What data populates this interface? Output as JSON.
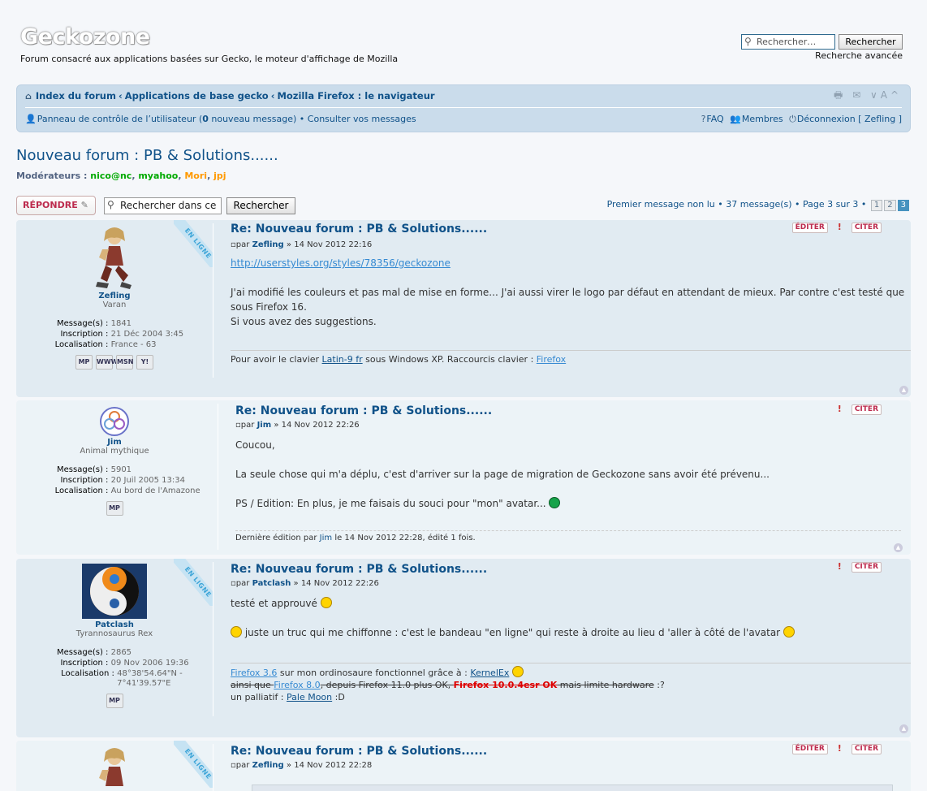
{
  "header": {
    "site_title": "Geckozone",
    "site_desc": "Forum consacré aux applications basées sur Gecko, le moteur d'affichage de Mozilla",
    "search_placeholder": "Rechercher…",
    "search_button": "Rechercher",
    "advanced_search": "Recherche avancée"
  },
  "navbar": {
    "crumbs": [
      "Index du forum",
      "Applications de base gecko",
      "Mozilla Firefox : le navigateur"
    ],
    "ucp_prefix": "Panneau de contrôle de l’utilisateur (",
    "ucp_count": "0",
    "ucp_suffix": " nouveau message)",
    "bullet": "•",
    "messages_link": "Consulter vos messages",
    "faq": "FAQ",
    "members": "Membres",
    "logout": "Déconnexion [ Zefling ]",
    "tools_glyphs": "🖶 ✉ ∨A^"
  },
  "forum": {
    "title": "Nouveau forum : PB & Solutions......",
    "moderators_label": "Modérateurs :",
    "mods": [
      "nico@nc",
      "myahoo",
      "Mori",
      "jpj"
    ],
    "mod_sep": ", "
  },
  "actionbar": {
    "reply_button": "RÉPONDRE",
    "search_topic_value": "Rechercher dans ce",
    "search_topic_button": "Rechercher",
    "unread_link": "Premier message non lu",
    "post_count": "37 message(s)",
    "page_info": "Page 3 sur 3",
    "pages": [
      "1",
      "2",
      "3"
    ],
    "bullet": "•"
  },
  "labels": {
    "online": "EN LIGNE",
    "messages": "Message(s) :",
    "inscription": "Inscription :",
    "localisation": "Localisation :",
    "by": "par",
    "edit": "ÉDITER",
    "quote": "CITER",
    "report_glyph": "!",
    "top_glyph": "▲"
  },
  "posts": [
    {
      "author": "Zefling",
      "rank": "Varan",
      "messages": "1841",
      "inscription": "21 Déc 2004 3:45",
      "localisation": "France - 63",
      "title": "Re: Nouveau forum : PB & Solutions......",
      "date": "14 Nov 2012 22:16",
      "link": "http://userstyles.org/styles/78356/geckozone",
      "p1": "J'ai modifié les couleurs et pas mal de mise en forme... J'ai aussi virer le logo par défaut en attendant de mieux. Par contre c'est testé que sous Firefox 16.",
      "p2": "Si vous avez des suggestions.",
      "sig_pre": "Pour avoir le clavier ",
      "sig_link1": "Latin-9 fr",
      "sig_mid": " sous Windows XP. Raccourcis clavier : ",
      "sig_link2": "Firefox",
      "contacts": [
        "MP",
        "WWW",
        "MSN",
        "Y!"
      ]
    },
    {
      "author": "Jim",
      "rank": "Animal mythique",
      "messages": "5901",
      "inscription": "20 Juil 2005 13:34",
      "localisation": "Au bord de l'Amazone",
      "title": "Re: Nouveau forum : PB & Solutions......",
      "date": "14 Nov 2012 22:26",
      "p1": "Coucou,",
      "p2": "La seule chose qui m'a déplu, c'est d'arriver sur la page de migration de Geckozone sans avoir été prévenu...",
      "p3": "PS / Edition: En plus, je me faisais du souci pour \"mon\" avatar...",
      "edit_pre": "Dernière édition par ",
      "edit_user": "Jim",
      "edit_post": " le 14 Nov 2012 22:28, édité 1 fois.",
      "contacts": [
        "MP"
      ]
    },
    {
      "author": "Patclash",
      "rank": "Tyrannosaurus Rex",
      "messages": "2865",
      "inscription": "09 Nov 2006 19:36",
      "localisation": "48°38'54.64\"N - 7°41'39.57\"E",
      "title": "Re: Nouveau forum : PB & Solutions......",
      "date": "14 Nov 2012 22:26",
      "p1": "testé et approuvé",
      "p2": " juste un truc qui me chiffonne : c'est le bandeau \"en ligne\" qui reste à droite au lieu d 'aller à côté de l'avatar",
      "sig_l1_link1": "Firefox 3.6",
      "sig_l1_mid": " sur mon ordinosaure fonctionnel grâce à : ",
      "sig_l1_link2": "KernelEx",
      "sig_l2_a": "ainsi que ",
      "sig_l2_link": "Firefox 8.0",
      "sig_l2_b": ", depuis Firefox 11.0 plus OK, ",
      "sig_l2_red": "Firefox 10.0.4esr OK",
      "sig_l2_c": " mais limite hardware",
      "sig_l2_d": " :?",
      "sig_l3_a": "un palliatif : ",
      "sig_l3_link": "Pale Moon",
      "sig_l3_b": " :D",
      "contacts": [
        "MP"
      ]
    },
    {
      "author": "Zefling",
      "title": "Re: Nouveau forum : PB & Solutions......",
      "date": "14 Nov 2012 22:28"
    }
  ]
}
